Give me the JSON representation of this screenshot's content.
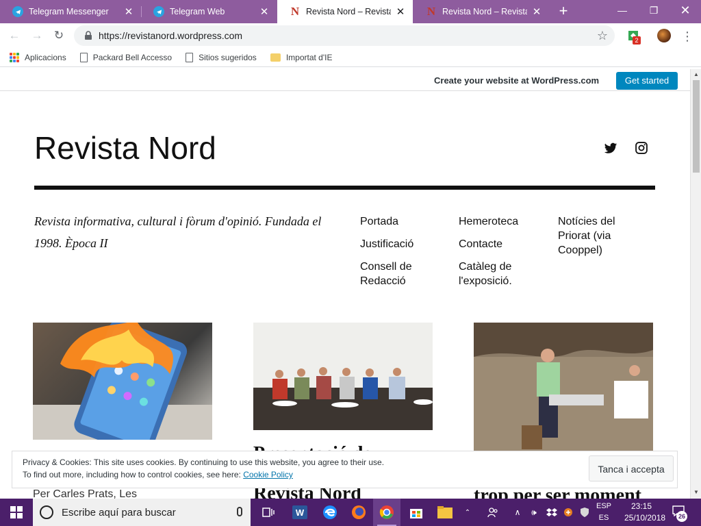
{
  "browser": {
    "tabs": [
      {
        "title": "Telegram Messenger",
        "favicon": "telegram-icon"
      },
      {
        "title": "Telegram Web",
        "favicon": "telegram-icon"
      },
      {
        "title": "Revista Nord – Revista inf",
        "favicon": "revista-nord-icon",
        "active": true
      },
      {
        "title": "Revista Nord – Revista inf",
        "favicon": "revista-nord-icon"
      }
    ],
    "url": "https://revistanord.wordpress.com",
    "extension_badge": "2",
    "bookmarks": [
      {
        "label": "Aplicacions",
        "icon": "apps-icon"
      },
      {
        "label": "Packard Bell Accesso",
        "icon": "page-icon"
      },
      {
        "label": "Sitios sugeridos",
        "icon": "page-icon"
      },
      {
        "label": "Importat d'IE",
        "icon": "folder-icon"
      }
    ]
  },
  "wp_bar": {
    "text": "Create your website at WordPress.com",
    "button": "Get started"
  },
  "site": {
    "title": "Revista Nord",
    "tagline": "Revista informativa, cultural i fòrum d'opinió. Fundada el 1998. Època II",
    "social": [
      "twitter-icon",
      "instagram-icon"
    ],
    "menu": {
      "col1": [
        "Portada",
        "Justificació",
        "Consell de Redacció"
      ],
      "col2": [
        "Hemeroteca",
        "Contacte",
        "Catàleg de l'exposició."
      ],
      "col3": [
        "Notícies del Priorat (via Cooppel)"
      ]
    },
    "posts": [
      {
        "image": "burning-phone",
        "text": "Per Carles Prats, Les"
      },
      {
        "image": "group-photo",
        "title_line1": "Presentació de",
        "title_line2": "Revista Nord"
      },
      {
        "image": "musician-cave",
        "title": "trop per ser moment"
      }
    ]
  },
  "cookie": {
    "line1": "Privacy & Cookies: This site uses cookies. By continuing to use this website, you agree to their use.",
    "line2_prefix": "To find out more, including how to control cookies, see here: ",
    "link": "Cookie Policy",
    "button": "Tanca i accepta"
  },
  "taskbar": {
    "search_placeholder": "Escribe aquí para buscar",
    "lang_top": "ESP",
    "lang_bottom": "ES",
    "time": "23:15",
    "date": "25/10/2018",
    "notifications": "26"
  },
  "colors": {
    "tabstrip": "#8e5c9e",
    "taskbar": "#4b1f6a",
    "wp_button": "#0087be"
  }
}
